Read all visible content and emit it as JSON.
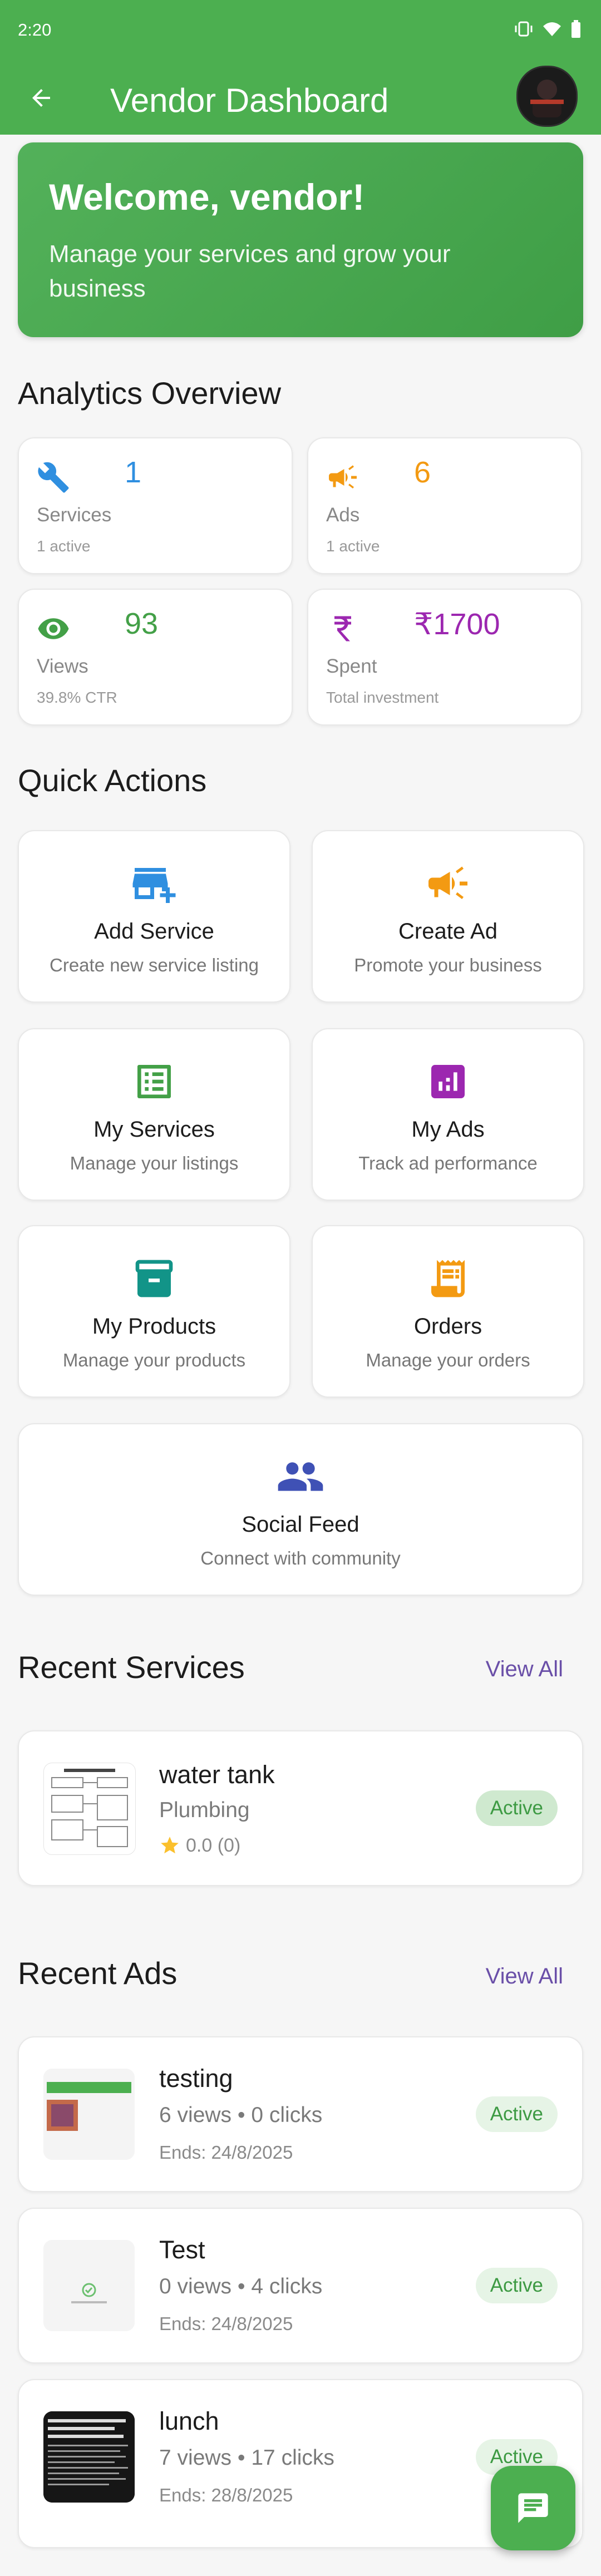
{
  "status_bar": {
    "time": "2:20"
  },
  "app_bar": {
    "title": "Vendor Dashboard"
  },
  "welcome": {
    "title": "Welcome, vendor!",
    "subtitle": "Manage your services and grow your business"
  },
  "analytics": {
    "title": "Analytics Overview",
    "cards": [
      {
        "icon": "wrench-icon",
        "value": "1",
        "label": "Services",
        "sub": "1 active",
        "color": "#2f8fe0"
      },
      {
        "icon": "megaphone-icon",
        "value": "6",
        "label": "Ads",
        "sub": "1 active",
        "color": "#f39a12"
      },
      {
        "icon": "eye-icon",
        "value": "93",
        "label": "Views",
        "sub": "39.8% CTR",
        "color": "#43a047"
      },
      {
        "icon": "rupee-icon",
        "value": "₹1700",
        "label": "Spent",
        "sub": "Total investment",
        "color": "#9c27b0"
      }
    ]
  },
  "quick_actions": {
    "title": "Quick Actions",
    "items": [
      {
        "icon": "add-store-icon",
        "title": "Add Service",
        "subtitle": "Create new service listing",
        "color": "#2f8fe0"
      },
      {
        "icon": "campaign-icon",
        "title": "Create Ad",
        "subtitle": "Promote your business",
        "color": "#f39a12"
      },
      {
        "icon": "list-icon",
        "title": "My Services",
        "subtitle": "Manage your listings",
        "color": "#43a047"
      },
      {
        "icon": "chart-icon",
        "title": "My Ads",
        "subtitle": "Track ad performance",
        "color": "#9c27b0"
      },
      {
        "icon": "archive-icon",
        "title": "My Products",
        "subtitle": "Manage your products",
        "color": "#129488"
      },
      {
        "icon": "receipt-icon",
        "title": "Orders",
        "subtitle": "Manage your orders",
        "color": "#f39a12"
      },
      {
        "icon": "people-icon",
        "title": "Social Feed",
        "subtitle": "Connect with community",
        "color": "#3f51b5"
      }
    ]
  },
  "recent_services": {
    "title": "Recent Services",
    "view_all": "View All",
    "items": [
      {
        "title": "water tank",
        "category": "Plumbing",
        "rating": "0.0 (0)",
        "status": "Active"
      }
    ]
  },
  "recent_ads": {
    "title": "Recent Ads",
    "view_all": "View All",
    "items": [
      {
        "title": "testing",
        "stats": "6 views • 0 clicks",
        "ends": "Ends: 24/8/2025",
        "status": "Active"
      },
      {
        "title": "Test",
        "stats": "0 views • 4 clicks",
        "ends": "Ends: 24/8/2025",
        "status": "Active"
      },
      {
        "title": "lunch",
        "stats": "7 views • 17 clicks",
        "ends": "Ends: 28/8/2025",
        "status": "Active"
      }
    ]
  },
  "fab": {
    "icon": "chat-icon"
  },
  "colors": {
    "primary": "#4caf50",
    "accent_link": "#6a4fa8",
    "badge_text": "#3d9a43"
  }
}
